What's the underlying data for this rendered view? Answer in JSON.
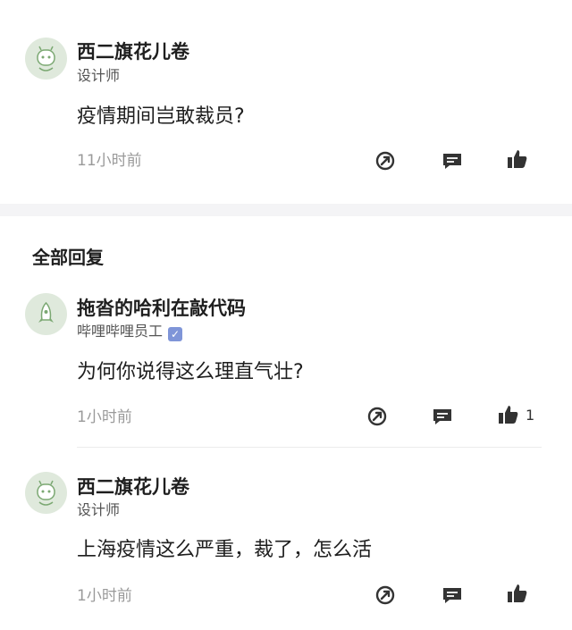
{
  "top_comment": {
    "username": "西二旗花儿卷",
    "role": "设计师",
    "text": "疫情期间岂敢裁员?",
    "time": "11小时前"
  },
  "section_title": "全部回复",
  "replies": [
    {
      "username": "拖沓的哈利在敲代码",
      "role": "哔哩哔哩员工",
      "verified": true,
      "text": "为何你说得这么理直气壮?",
      "time": "1小时前",
      "like_count": "1"
    },
    {
      "username": "西二旗花儿卷",
      "role": "设计师",
      "text": "上海疫情这么严重，裁了，怎么活",
      "time": "1小时前"
    }
  ],
  "icons": {
    "share": "share-icon",
    "comment": "comment-icon",
    "like": "thumbs-up-icon"
  },
  "colors": {
    "avatar_bg": "#dfe9dc",
    "icon": "#333333",
    "muted": "#9a9a9a",
    "verified_badge": "#7f95d8"
  }
}
